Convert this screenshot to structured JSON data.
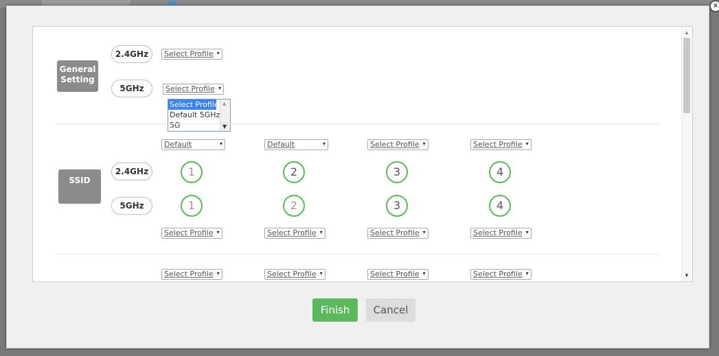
{
  "dialog": {
    "close_icon": "×",
    "finish_label": "Finish",
    "cancel_label": "Cancel"
  },
  "general": {
    "label_line1": "General",
    "label_line2": "Setting",
    "band_24": "2.4GHz",
    "band_5": "5GHz",
    "select_24": "Select Profile",
    "select_5": "Select Profile",
    "dropdown_options": [
      "Select Profile",
      "Default 5GHz",
      "5G"
    ]
  },
  "ssid": {
    "label": "SSID",
    "band_24": "2.4GHz",
    "band_5": "5GHz",
    "top_selects": [
      "Default",
      "Default",
      "Select Profile",
      "Select Profile"
    ],
    "circles_24": [
      "1",
      "2",
      "3",
      "4"
    ],
    "circles_5": [
      "1",
      "2",
      "3",
      "4"
    ],
    "bottom_selects": [
      "Select Profile",
      "Select Profile",
      "Select Profile",
      "Select Profile"
    ]
  },
  "next_section": {
    "selects": [
      "Select Profile",
      "Select Profile",
      "Select Profile",
      "Select Profile"
    ]
  },
  "colors": {
    "accent_green": "#5cb85c",
    "gray_block": "#8b8b8b",
    "dropdown_highlight": "#3a82f7"
  }
}
